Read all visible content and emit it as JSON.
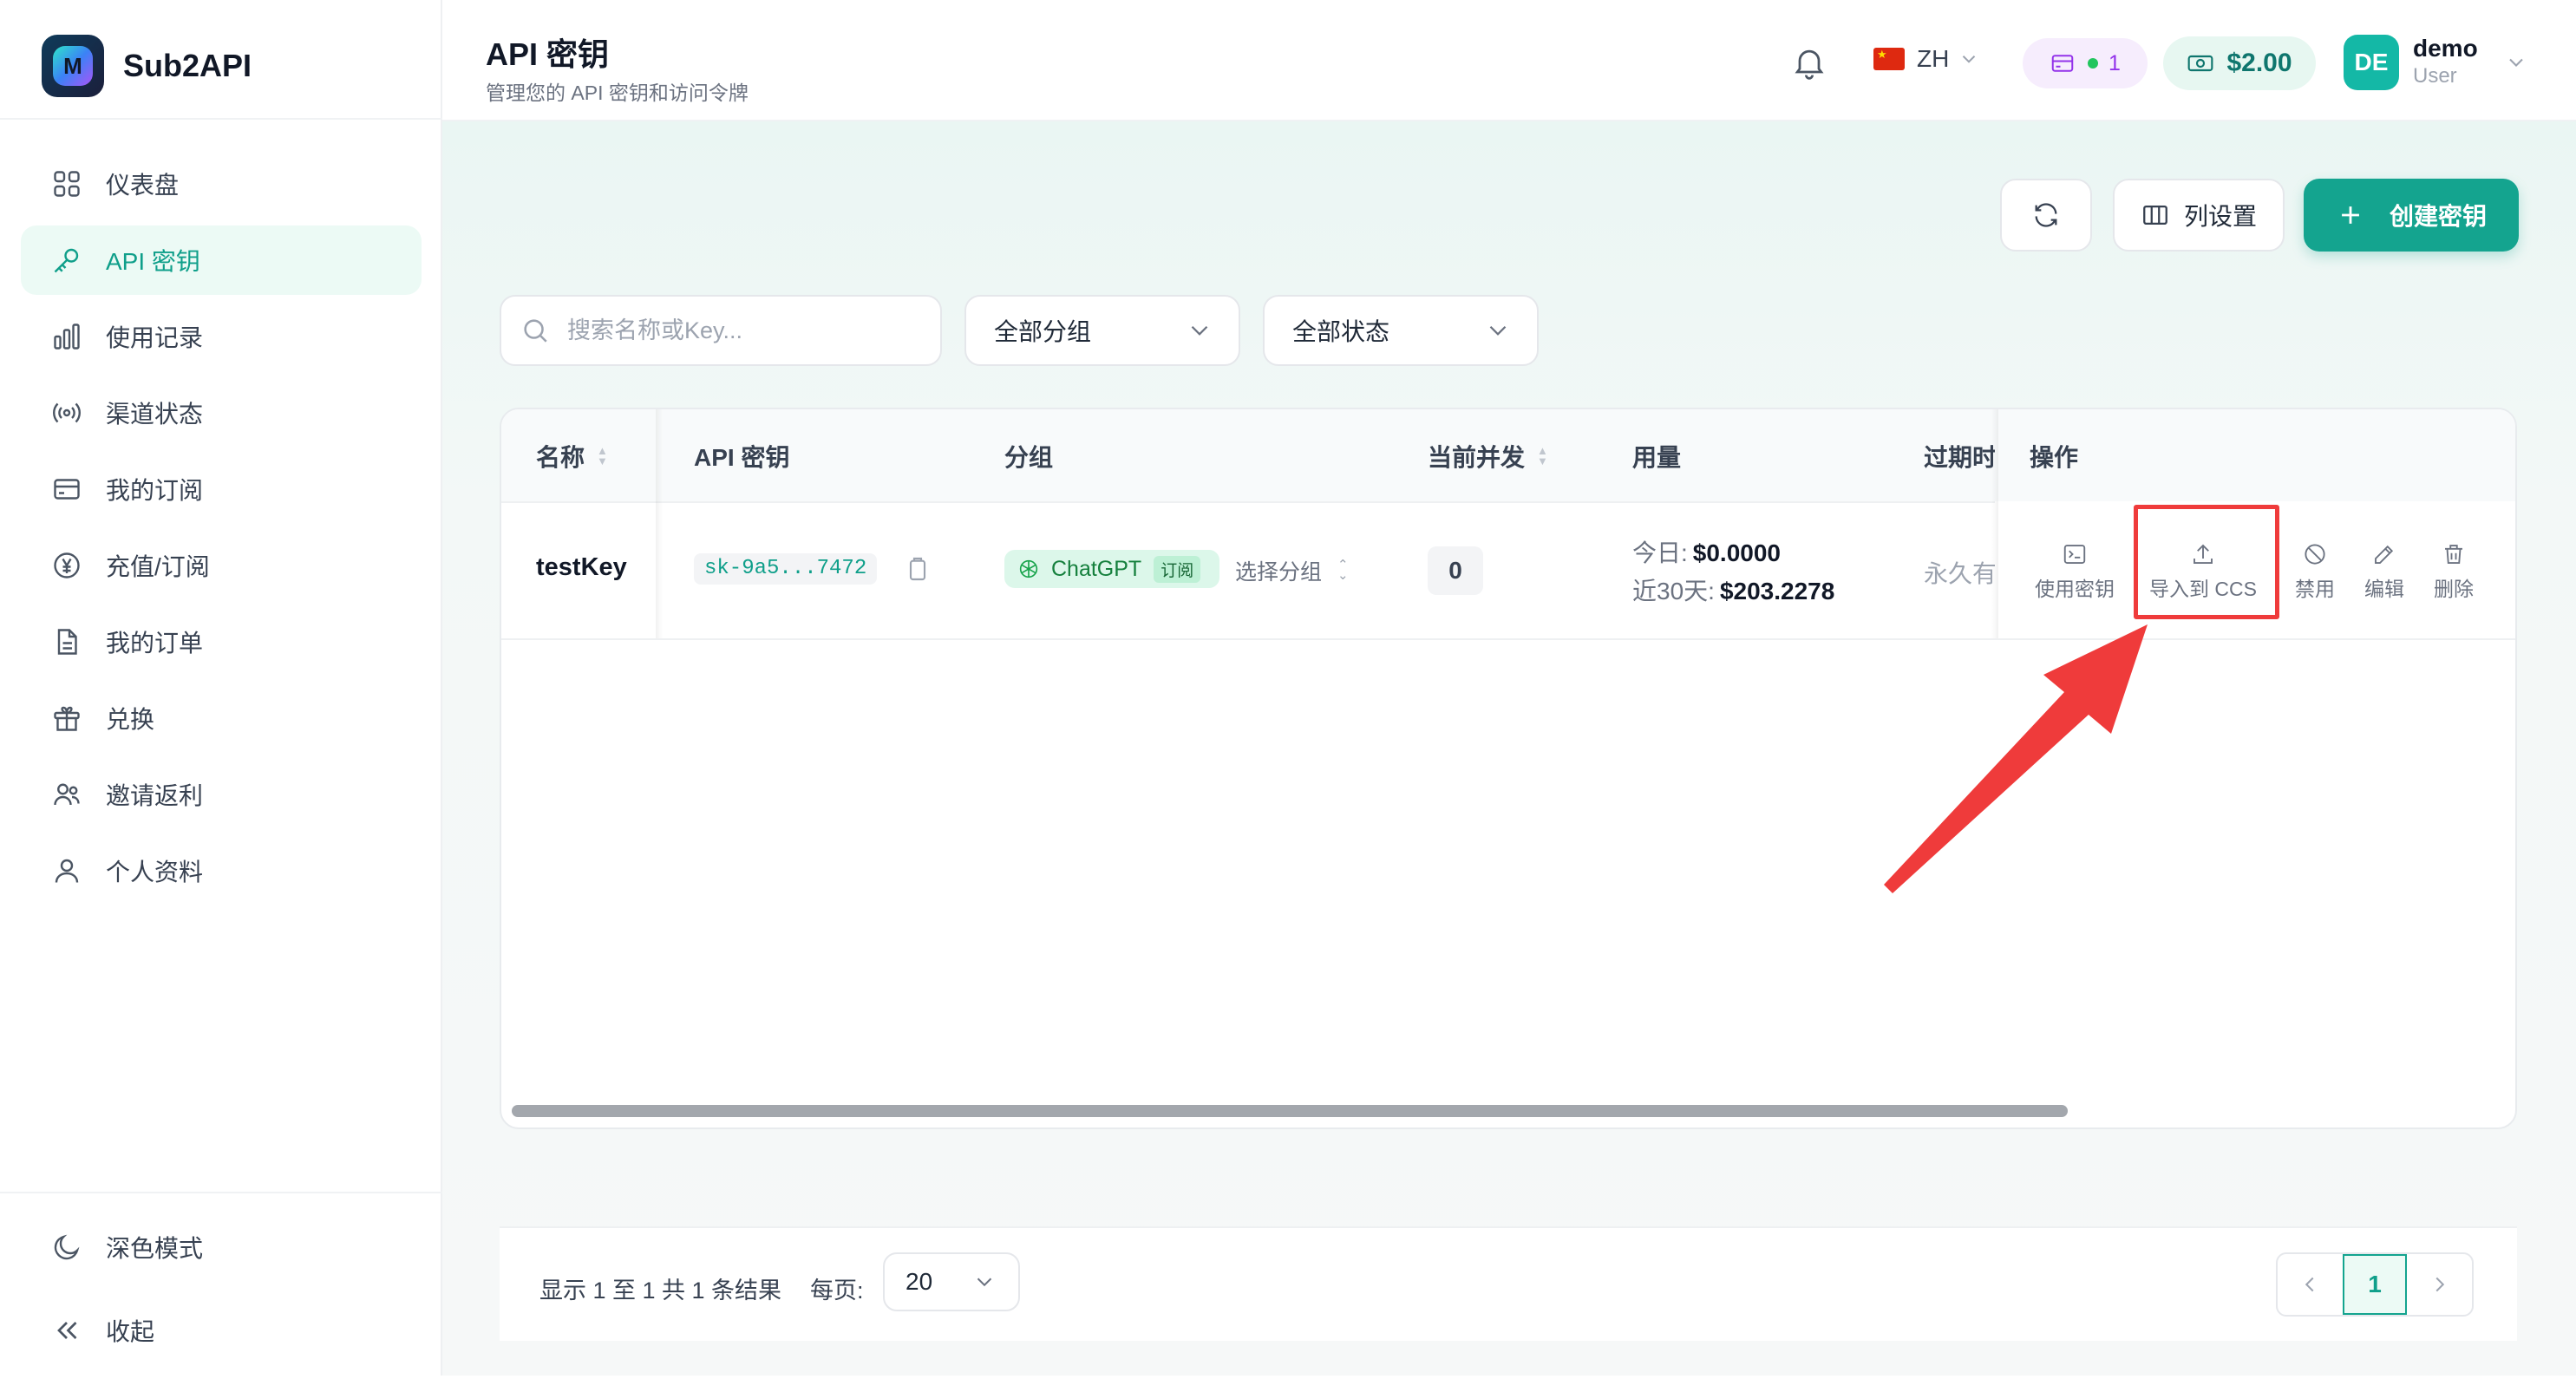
{
  "brand": {
    "name": "Sub2API",
    "logo_letter": "M"
  },
  "sidebar": {
    "items": [
      {
        "label": "仪表盘",
        "icon": "grid-icon"
      },
      {
        "label": "API 密钥",
        "icon": "key-icon",
        "active": true
      },
      {
        "label": "使用记录",
        "icon": "bar-chart-icon"
      },
      {
        "label": "渠道状态",
        "icon": "signal-icon"
      },
      {
        "label": "我的订阅",
        "icon": "card-icon"
      },
      {
        "label": "充值/订阅",
        "icon": "yen-icon"
      },
      {
        "label": "我的订单",
        "icon": "document-icon"
      },
      {
        "label": "兑换",
        "icon": "gift-icon"
      },
      {
        "label": "邀请返利",
        "icon": "users-icon"
      },
      {
        "label": "个人资料",
        "icon": "user-icon"
      }
    ],
    "bottom": [
      {
        "label": "深色模式",
        "icon": "moon-icon"
      },
      {
        "label": "收起",
        "icon": "collapse-icon"
      }
    ]
  },
  "header": {
    "title": "API 密钥",
    "subtitle": "管理您的 API 密钥和访问令牌",
    "language": "ZH",
    "subscription_count": "1",
    "balance": "$2.00",
    "user": {
      "initials": "DE",
      "name": "demo",
      "role": "User"
    }
  },
  "toolbar": {
    "columns_label": "列设置",
    "create_label": "创建密钥"
  },
  "filters": {
    "search_placeholder": "搜索名称或Key...",
    "group_select": "全部分组",
    "status_select": "全部状态"
  },
  "table": {
    "headers": {
      "name": "名称",
      "key": "API 密钥",
      "group": "分组",
      "concurrency": "当前并发",
      "usage": "用量",
      "expires": "过期时间",
      "actions": "操作"
    },
    "rows": [
      {
        "name": "testKey",
        "key": "sk-9a5...7472",
        "group_name": "ChatGPT",
        "group_tag": "订阅",
        "group_select": "选择分组",
        "concurrency": "0",
        "usage_today_label": "今日:",
        "usage_today": "$0.0000",
        "usage_30d_label": "近30天:",
        "usage_30d": "$203.2278",
        "expires": "永久有效",
        "actions": {
          "use": "使用密钥",
          "import": "导入到 CCS",
          "disable": "禁用",
          "edit": "编辑",
          "delete": "删除"
        }
      }
    ]
  },
  "pagination": {
    "info": "显示 1 至 1 共 1 条结果",
    "per_page_label": "每页:",
    "per_page": "20",
    "current_page": "1"
  },
  "colors": {
    "accent": "#14a48f",
    "highlight": "#ef3b3b"
  }
}
